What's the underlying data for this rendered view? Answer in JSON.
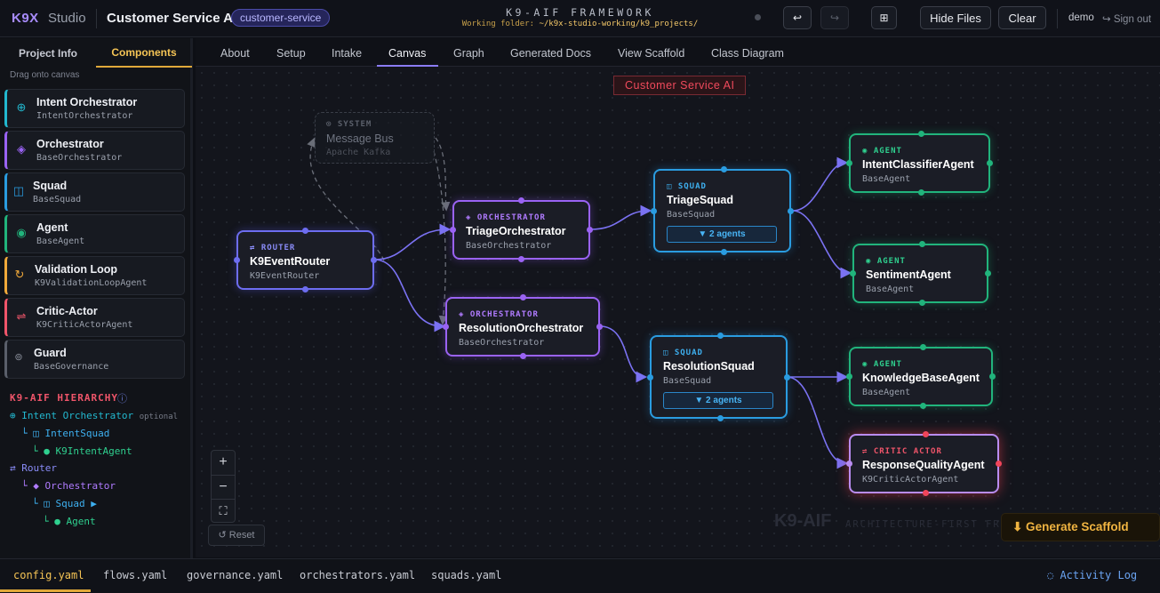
{
  "header": {
    "brand": "K9X",
    "studio": "Studio",
    "project_title": "Customer Service AI",
    "project_badge": "customer-service",
    "framework_title": "K9-AIF FRAMEWORK",
    "working_folder_label": "Working folder:",
    "working_folder_path": "~/k9x-studio-working/k9_projects/",
    "undo_icon": "↩",
    "redo_icon": "↪",
    "grid_icon": "⊞",
    "hide_files": "Hide Files",
    "clear": "Clear",
    "user": "demo",
    "sign_out": "↪ Sign out"
  },
  "sidebar": {
    "tabs": [
      "Project Info",
      "Components"
    ],
    "active_tab": "Components",
    "drag_hint": "Drag onto canvas",
    "components": [
      {
        "icon": "⊕",
        "name": "Intent Orchestrator",
        "class": "IntentOrchestrator",
        "color": "#22b8cf"
      },
      {
        "icon": "◈",
        "name": "Orchestrator",
        "class": "BaseOrchestrator",
        "color": "#9a63f3"
      },
      {
        "icon": "◫",
        "name": "Squad",
        "class": "BaseSquad",
        "color": "#2a9ce0"
      },
      {
        "icon": "◉",
        "name": "Agent",
        "class": "BaseAgent",
        "color": "#21b47c"
      },
      {
        "icon": "↻",
        "name": "Validation Loop",
        "class": "K9ValidationLoopAgent",
        "color": "#f0a93a"
      },
      {
        "icon": "⇌",
        "name": "Critic-Actor",
        "class": "K9CriticActorAgent",
        "color": "#f0556a"
      },
      {
        "icon": "⊚",
        "name": "Guard",
        "class": "BaseGovernance",
        "color": "#7a7f8b"
      }
    ],
    "hierarchy_title": "K9-AIF HIERARCHY",
    "hierarchy_info_icon": "ⓘ",
    "hierarchy": [
      {
        "text": "⊕ Intent Orchestrator",
        "note": "optional",
        "color": "#22b8cf"
      },
      {
        "text": "└ ◫ IntentSquad",
        "note": "",
        "color": "#3eb0f0"
      },
      {
        "text": "└ ● K9IntentAgent",
        "note": "",
        "color": "#2fd08f"
      },
      {
        "text": "⇄ Router",
        "note": "",
        "color": "#8a8cf8"
      },
      {
        "text": "└ ◆ Orchestrator",
        "note": "",
        "color": "#b07bff"
      },
      {
        "text": "└ ◫ Squad ▶",
        "note": "",
        "color": "#3eb0f0"
      },
      {
        "text": "└ ● Agent",
        "note": "",
        "color": "#2fd08f"
      }
    ]
  },
  "tabs": [
    "About",
    "Setup",
    "Intake",
    "Canvas",
    "Graph",
    "Generated Docs",
    "View Scaffold",
    "Class Diagram"
  ],
  "active_tab": "Canvas",
  "canvas": {
    "title": "Customer Service AI",
    "nodes": {
      "system": {
        "kind": "⊙ SYSTEM",
        "name": "Message Bus",
        "cls": "Apache Kafka"
      },
      "router": {
        "kind": "⇄ ROUTER",
        "name": "K9EventRouter",
        "cls": "K9EventRouter"
      },
      "triage_orch": {
        "kind": "◈ ORCHESTRATOR",
        "name": "TriageOrchestrator",
        "cls": "BaseOrchestrator"
      },
      "resolution_orch": {
        "kind": "◈ ORCHESTRATOR",
        "name": "ResolutionOrchestrator",
        "cls": "BaseOrchestrator"
      },
      "triage_squad": {
        "kind": "◫ SQUAD",
        "name": "TriageSquad",
        "cls": "BaseSquad",
        "agents": "▼ 2 agents"
      },
      "resolution_squad": {
        "kind": "◫ SQUAD",
        "name": "ResolutionSquad",
        "cls": "BaseSquad",
        "agents": "▼ 2 agents"
      },
      "intent_agent": {
        "kind": "◉ AGENT",
        "name": "IntentClassifierAgent",
        "cls": "BaseAgent"
      },
      "sentiment_agent": {
        "kind": "◉ AGENT",
        "name": "SentimentAgent",
        "cls": "BaseAgent"
      },
      "kb_agent": {
        "kind": "◉ AGENT",
        "name": "KnowledgeBaseAgent",
        "cls": "BaseAgent"
      },
      "critic_agent": {
        "kind": "⇌ CRITIC ACTOR",
        "name": "ResponseQualityAgent",
        "cls": "K9CriticActorAgent"
      }
    },
    "zoom_in": "+",
    "zoom_out": "−",
    "fit": "⛶",
    "reset": "↺ Reset",
    "watermark": "K9-AIF",
    "watermark_sub": "ARCHITECTURE-FIRST FRAME",
    "generate_scaffold": "⬇ Generate Scaffold"
  },
  "bottom": {
    "files": [
      "config.yaml",
      "flows.yaml",
      "governance.yaml",
      "orchestrators.yaml",
      "squads.yaml"
    ],
    "active_file": "config.yaml",
    "activity_log": "◌ Activity Log"
  }
}
